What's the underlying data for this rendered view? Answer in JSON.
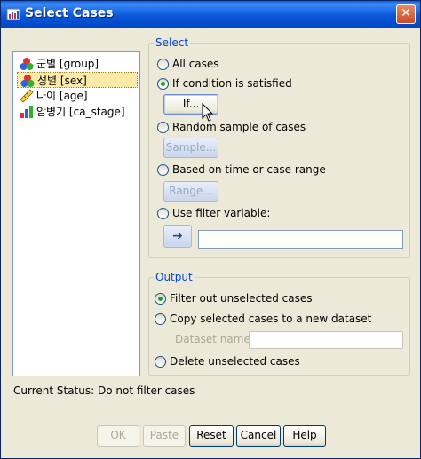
{
  "window": {
    "title": "Select Cases",
    "close_symbol": "✕"
  },
  "variables": [
    {
      "label": "군별 [group]",
      "icon": "nominal-icon",
      "selected": false
    },
    {
      "label": "성별 [sex]",
      "icon": "nominal-icon",
      "selected": true
    },
    {
      "label": "나이 [age]",
      "icon": "scale-ruler-icon",
      "selected": false
    },
    {
      "label": "암병기 [ca_stage]",
      "icon": "ordinal-bar-icon",
      "selected": false
    }
  ],
  "select": {
    "title": "Select",
    "all_cases": "All cases",
    "if_condition": "If condition is satisfied",
    "if_button": "If...",
    "random_sample": "Random sample of cases",
    "sample_button": "Sample...",
    "time_range": "Based on time or case range",
    "range_button": "Range...",
    "filter_variable": "Use filter variable:",
    "arrow_symbol": "➔",
    "filter_value": "",
    "selected_option": "if_condition"
  },
  "output": {
    "title": "Output",
    "filter_out": "Filter out unselected cases",
    "copy_dataset": "Copy selected cases to a new dataset",
    "dataset_name_label": "Dataset name:",
    "dataset_name_value": "",
    "delete": "Delete unselected cases",
    "selected_option": "filter_out"
  },
  "status": {
    "text": "Current Status: Do not filter cases"
  },
  "buttons": {
    "ok": "OK",
    "paste": "Paste",
    "reset": "Reset",
    "cancel": "Cancel",
    "help": "Help"
  },
  "colors": {
    "titlebar": "#0a58d8",
    "dialog_bg": "#ece9d8",
    "group_title": "#0046d5",
    "selected_item": "#fde9a8"
  }
}
